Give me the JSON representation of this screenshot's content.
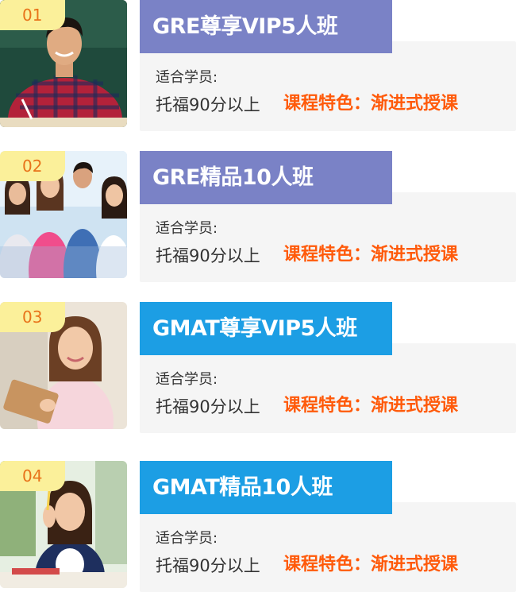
{
  "courses": [
    {
      "number": "01",
      "title": "GRE尊享VIP5人班",
      "suit_label": "适合学员:",
      "requirement": "托福90分以上",
      "feature": "课程特色：渐进式授课",
      "photo": "student-smiling-boy-photo"
    },
    {
      "number": "02",
      "title": "GRE精品10人班",
      "suit_label": "适合学员:",
      "requirement": "托福90分以上",
      "feature": "课程特色：渐进式授课",
      "photo": "student-group-photo"
    },
    {
      "number": "03",
      "title": "GMAT尊享VIP5人班",
      "suit_label": "适合学员:",
      "requirement": "托福90分以上",
      "feature": "课程特色：渐进式授课",
      "photo": "student-girl-tablet-photo"
    },
    {
      "number": "04",
      "title": "GMAT精品10人班",
      "suit_label": "适合学员:",
      "requirement": "托福90分以上",
      "feature": "课程特色：渐进式授课",
      "photo": "student-girl-studying-photo"
    }
  ],
  "colors": {
    "gre_title_bg": "#7a82c6",
    "gmat_title_bg": "#1c9ee4",
    "tag_bg": "#fbf09a",
    "tag_text": "#e8731a",
    "feature_text": "#ff5a0a",
    "info_bg": "#f5f5f5"
  }
}
